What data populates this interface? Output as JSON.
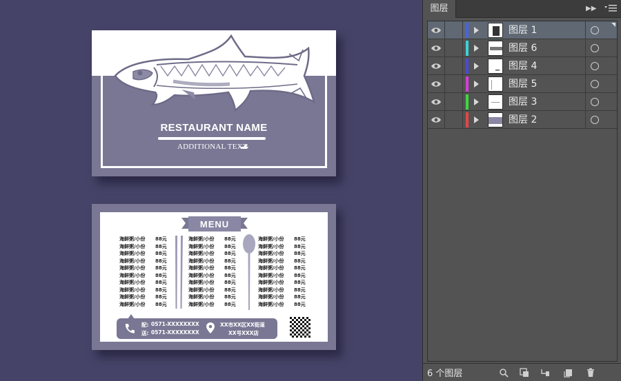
{
  "front_card": {
    "restaurant_name": "RESTAURANT NAME",
    "additional_text": "ADDITIONAL TEXT"
  },
  "back_card": {
    "menu_title": "MENU",
    "item_name": "海鲜粥/小份",
    "item_price": "88元",
    "columns": [
      {
        "rows": 10
      },
      {
        "rows": 10
      },
      {
        "rows": 10
      }
    ],
    "contact": {
      "delivery_label": "配:",
      "phone_1": "0571-XXXXXXXX",
      "send_label": "送:",
      "phone_2": "0571-XXXXXXXX",
      "address_line_1": "XX市XX区XX街道",
      "address_line_2": "XX号XXX店"
    }
  },
  "layers_panel": {
    "tab_label": "图层",
    "layers": [
      {
        "name": "图层 1",
        "color": "#4a64d8",
        "selected": true
      },
      {
        "name": "图层 6",
        "color": "#3fd1d8",
        "selected": false
      },
      {
        "name": "图层 4",
        "color": "#4a4ad0",
        "selected": false
      },
      {
        "name": "图层 5",
        "color": "#d43fd8",
        "selected": false
      },
      {
        "name": "图层 3",
        "color": "#3fd83f",
        "selected": false
      },
      {
        "name": "图层 2",
        "color": "#e04848",
        "selected": false
      }
    ],
    "layer_count": "6 个图层"
  },
  "colors": {
    "canvas_bg": "#454367",
    "card_purple": "#7a7794",
    "panel_bg": "#535353"
  },
  "icons": [
    "eye-icon",
    "expand-triangle-icon",
    "target-circle-icon",
    "locate-object-icon",
    "make-clipping-mask-icon",
    "new-sublayer-icon",
    "new-layer-icon",
    "delete-icon",
    "panel-menu-icon",
    "collapse-icon"
  ]
}
